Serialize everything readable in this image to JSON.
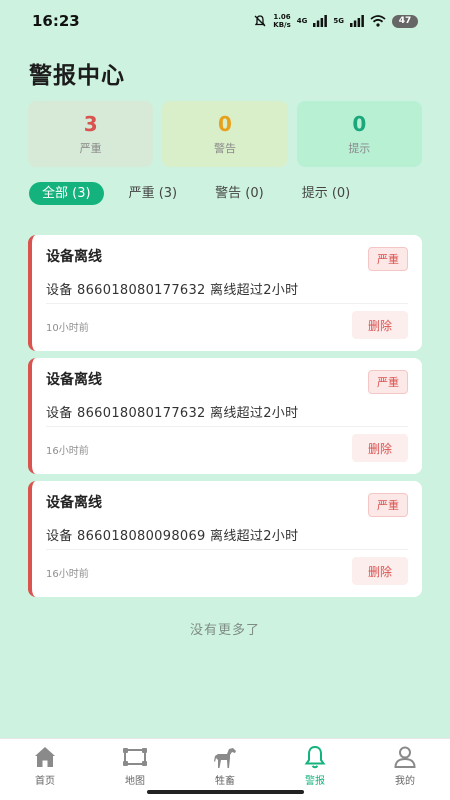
{
  "status_bar": {
    "time": "16:23",
    "net_speed_value": "1.06",
    "net_speed_unit": "KB/s",
    "net_4g": "4G",
    "net_5g": "5G",
    "battery": "47"
  },
  "page": {
    "title": "警报中心"
  },
  "stats": [
    {
      "value": "3",
      "label": "严重",
      "color": "#d9534f"
    },
    {
      "value": "0",
      "label": "警告",
      "color": "#e7a11c"
    },
    {
      "value": "0",
      "label": "提示",
      "color": "#1aa87a"
    }
  ],
  "tabs": [
    {
      "label": "全部 (3)",
      "active": true
    },
    {
      "label": "严重 (3)",
      "active": false
    },
    {
      "label": "警告 (0)",
      "active": false
    },
    {
      "label": "提示 (0)",
      "active": false
    }
  ],
  "alerts": [
    {
      "title": "设备离线",
      "severity": "严重",
      "description": "设备 866018080177632 离线超过2小时",
      "time": "10小时前",
      "delete_label": "删除"
    },
    {
      "title": "设备离线",
      "severity": "严重",
      "description": "设备 866018080177632 离线超过2小时",
      "time": "16小时前",
      "delete_label": "删除"
    },
    {
      "title": "设备离线",
      "severity": "严重",
      "description": "设备 866018080098069 离线超过2小时",
      "time": "16小时前",
      "delete_label": "删除"
    }
  ],
  "no_more_text": "没有更多了",
  "nav": {
    "items": [
      {
        "label": "首页",
        "icon": "home-icon",
        "active": false
      },
      {
        "label": "地图",
        "icon": "map-icon",
        "active": false
      },
      {
        "label": "牲畜",
        "icon": "horse-icon",
        "active": false
      },
      {
        "label": "警报",
        "icon": "bell-icon",
        "active": true
      },
      {
        "label": "我的",
        "icon": "user-icon",
        "active": false
      }
    ]
  },
  "colors": {
    "accent": "#14b37d",
    "danger": "#d9534f",
    "background": "#cdf3e0"
  }
}
